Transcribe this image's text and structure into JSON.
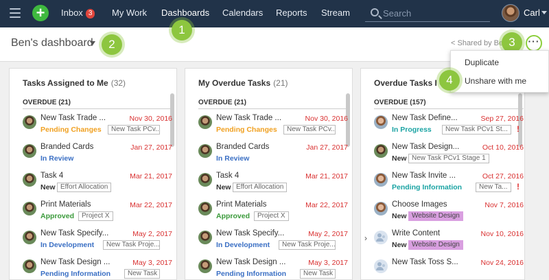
{
  "nav": {
    "items": [
      {
        "label": "Inbox",
        "badge": "3"
      },
      {
        "label": "My Work"
      },
      {
        "label": "Dashboards"
      },
      {
        "label": "Calendars"
      },
      {
        "label": "Reports"
      },
      {
        "label": "Stream"
      }
    ],
    "search_placeholder": "Search",
    "user": "Carl"
  },
  "header": {
    "dashboard_title": "Ben's dashboard",
    "shared_by": "Shared by Ben"
  },
  "menu": {
    "items": [
      "Duplicate",
      "Unshare with me"
    ]
  },
  "markers": [
    "1",
    "2",
    "3",
    "4"
  ],
  "panels": [
    {
      "title": "Tasks Assigned to Me",
      "count": "(32)",
      "section": "OVERDUE (21)",
      "rows": [
        {
          "name": "New Task Trade ...",
          "date": "Nov 30, 2016",
          "status": "Pending Changes",
          "status_color": "#f0a020",
          "tag": "New Task PCv...",
          "avatar": "m"
        },
        {
          "name": "Branded Cards",
          "date": "Jan 27, 2017",
          "status": "In Review",
          "status_color": "#3a6fc4",
          "tag": "",
          "avatar": "m"
        },
        {
          "name": "Task 4",
          "date": "Mar 21, 2017",
          "status": "New",
          "status_color": "#333333",
          "tag": "Effort Allocation",
          "avatar": "m"
        },
        {
          "name": "Print Materials",
          "date": "Mar 22, 2017",
          "status": "Approved",
          "status_color": "#3a9a3a",
          "tag": "Project X",
          "avatar": "m"
        },
        {
          "name": "New Task Specify...",
          "date": "May 2, 2017",
          "status": "In Development",
          "status_color": "#3a6fc4",
          "tag": "New Task Proje...",
          "avatar": "m"
        },
        {
          "name": "New Task Design ...",
          "date": "May 3, 2017",
          "status": "Pending Information",
          "status_color": "#3a6fc4",
          "tag": "New Task",
          "avatar": "m"
        }
      ]
    },
    {
      "title": "My Overdue Tasks",
      "count": "(21)",
      "section": "OVERDUE (21)",
      "rows": [
        {
          "name": "New Task Trade ...",
          "date": "Nov 30, 2016",
          "status": "Pending Changes",
          "status_color": "#f0a020",
          "tag": "New Task PCv...",
          "avatar": "m"
        },
        {
          "name": "Branded Cards",
          "date": "Jan 27, 2017",
          "status": "In Review",
          "status_color": "#3a6fc4",
          "tag": "",
          "avatar": "m"
        },
        {
          "name": "Task 4",
          "date": "Mar 21, 2017",
          "status": "New",
          "status_color": "#333333",
          "tag": "Effort Allocation",
          "avatar": "m"
        },
        {
          "name": "Print Materials",
          "date": "Mar 22, 2017",
          "status": "Approved",
          "status_color": "#3a9a3a",
          "tag": "Project X",
          "avatar": "m"
        },
        {
          "name": "New Task Specify...",
          "date": "May 2, 2017",
          "status": "In Development",
          "status_color": "#3a6fc4",
          "tag": "New Task Proje...",
          "avatar": "m"
        },
        {
          "name": "New Task Design ...",
          "date": "May 3, 2017",
          "status": "Pending Information",
          "status_color": "#3a6fc4",
          "tag": "New Task",
          "avatar": "m"
        }
      ]
    },
    {
      "title": "Overdue Tasks I Cr",
      "count": "",
      "section": "OVERDUE (157)",
      "rows": [
        {
          "name": "New Task Define...",
          "date": "Sep 27, 2016",
          "status": "In Progress",
          "status_color": "#1aa3a3",
          "tag": "New Task PCv1 St...",
          "avatar": "f",
          "flag": "!"
        },
        {
          "name": "New Task Design...",
          "date": "Oct 10, 2016",
          "status": "New",
          "status_color": "#333333",
          "tag": "New Task PCv1 Stage 1",
          "avatar": "m"
        },
        {
          "name": "New Task Invite ...",
          "date": "Oct 27, 2016",
          "status": "Pending Information",
          "status_color": "#1aa3a3",
          "tag": "New Ta...",
          "avatar": "f",
          "flag": "!"
        },
        {
          "name": "Choose Images",
          "date": "Nov 7, 2016",
          "status": "New",
          "status_color": "#333333",
          "tag": "Website Design",
          "tag_pink": true,
          "avatar": "f"
        },
        {
          "name": "Write Content",
          "date": "Nov 10, 2016",
          "status": "New",
          "status_color": "#333333",
          "tag": "Website Design",
          "tag_pink": true,
          "avatar": "g"
        },
        {
          "name": "New Task Toss S...",
          "date": "Nov 24, 2016",
          "status": "",
          "status_color": "#333333",
          "tag": "",
          "avatar": "g"
        }
      ]
    }
  ]
}
